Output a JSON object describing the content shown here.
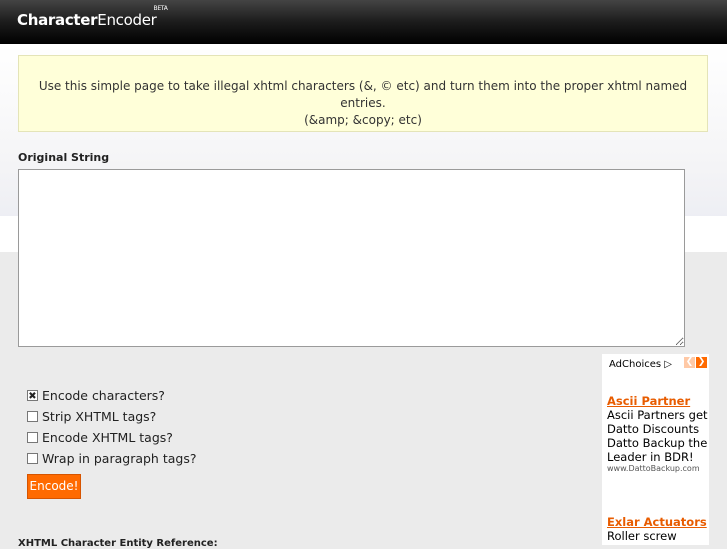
{
  "header": {
    "logo_bold": "Character",
    "logo_regular": "Encoder",
    "logo_badge": "BETA"
  },
  "intro": {
    "line1": "Use this simple page to take illegal xhtml characters (&, © etc) and turn them into the proper xhtml named entries.",
    "line2": "(&amp; &copy; etc)"
  },
  "form": {
    "original_label": "Original String",
    "original_value": "",
    "options": [
      {
        "label": "Encode characters?",
        "checked": true
      },
      {
        "label": "Strip XHTML tags?",
        "checked": false
      },
      {
        "label": "Encode XHTML tags?",
        "checked": false
      },
      {
        "label": "Wrap in paragraph tags?",
        "checked": false
      }
    ],
    "encode_label": "Encode!"
  },
  "bottom": {
    "heading": "XHTML Character Entity Reference:"
  },
  "ad": {
    "choices_label": "AdChoices",
    "items": [
      {
        "title": "Ascii Partner",
        "text": "Ascii Partners get Datto Discounts Datto Backup the Leader in BDR!",
        "url": "www.DattoBackup.com"
      },
      {
        "title": "Exlar Actuators",
        "text": "Roller screw"
      }
    ]
  },
  "colors": {
    "accent": "#ff6a00",
    "intro_bg": "#ffffd9",
    "header_bg": "#000000"
  }
}
